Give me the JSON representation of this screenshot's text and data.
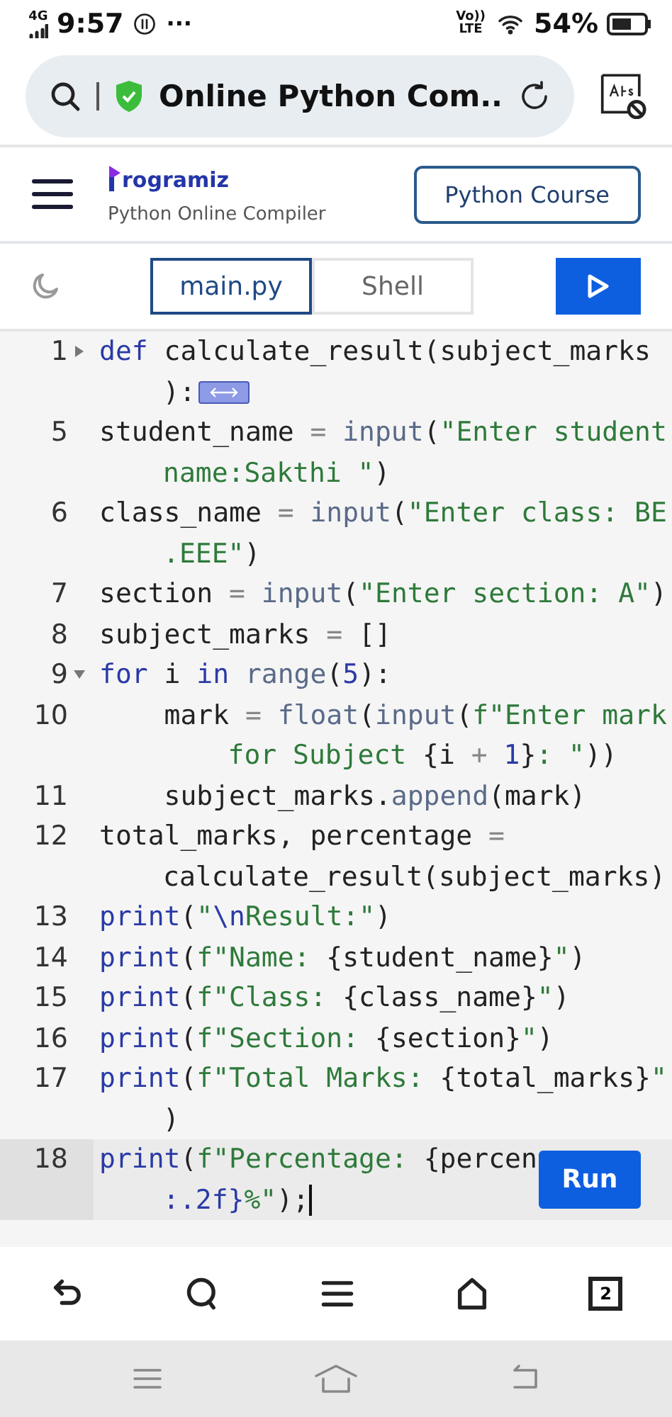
{
  "status_bar": {
    "network": "4G",
    "time": "9:57",
    "more": "···",
    "volte_top": "Vo))",
    "volte_bottom": "LTE",
    "battery": "54%"
  },
  "address_bar": {
    "title": "Online Python Com.."
  },
  "header": {
    "logo_text": "rogramiz",
    "subtitle": "Python Online Compiler",
    "course_button": "Python Course"
  },
  "tabs": [
    {
      "label": "main.py",
      "selected": true
    },
    {
      "label": "Shell",
      "selected": false
    }
  ],
  "editor": {
    "lines": [
      {
        "number": "1",
        "foldable": true,
        "collapsed": true,
        "active": false,
        "rows": [
          {
            "tokens": [
              {
                "text": "def",
                "kind": "keyword"
              },
              {
                "text": " calculate_result(subject_marks",
                "kind": "plain"
              }
            ]
          },
          {
            "tokens": [
              {
                "text": "):",
                "kind": "plain"
              }
            ]
          }
        ]
      },
      {
        "number": "5",
        "foldable": false,
        "active": false,
        "rows": [
          {
            "tokens": [
              {
                "text": "student_name ",
                "kind": "plain"
              },
              {
                "text": "= ",
                "kind": "operator"
              },
              {
                "text": "input",
                "kind": "builtin"
              },
              {
                "text": "(",
                "kind": "plain"
              },
              {
                "text": "\"Enter student",
                "kind": "string"
              }
            ]
          },
          {
            "tokens": [
              {
                "text": "name:Sakthi \"",
                "kind": "string"
              },
              {
                "text": ")",
                "kind": "plain"
              }
            ]
          }
        ]
      },
      {
        "number": "6",
        "foldable": false,
        "active": false,
        "rows": [
          {
            "tokens": [
              {
                "text": "class_name ",
                "kind": "plain"
              },
              {
                "text": "= ",
                "kind": "operator"
              },
              {
                "text": "input",
                "kind": "builtin"
              },
              {
                "text": "(",
                "kind": "plain"
              },
              {
                "text": "\"Enter class: BE",
                "kind": "string"
              }
            ]
          },
          {
            "tokens": [
              {
                "text": ".EEE\"",
                "kind": "string"
              },
              {
                "text": ")",
                "kind": "plain"
              }
            ]
          }
        ]
      },
      {
        "number": "7",
        "foldable": false,
        "active": false,
        "rows": [
          {
            "tokens": [
              {
                "text": "section ",
                "kind": "plain"
              },
              {
                "text": "= ",
                "kind": "operator"
              },
              {
                "text": "input",
                "kind": "builtin"
              },
              {
                "text": "(",
                "kind": "plain"
              },
              {
                "text": "\"Enter section: A\"",
                "kind": "string"
              },
              {
                "text": ")",
                "kind": "plain"
              }
            ]
          }
        ]
      },
      {
        "number": "8",
        "foldable": false,
        "active": false,
        "rows": [
          {
            "tokens": [
              {
                "text": "subject_marks ",
                "kind": "plain"
              },
              {
                "text": "= ",
                "kind": "operator"
              },
              {
                "text": "[]",
                "kind": "plain"
              }
            ]
          }
        ]
      },
      {
        "number": "9",
        "foldable": true,
        "collapsed": false,
        "active": false,
        "rows": [
          {
            "tokens": [
              {
                "text": "for",
                "kind": "keyword"
              },
              {
                "text": " i ",
                "kind": "plain"
              },
              {
                "text": "in ",
                "kind": "keyword"
              },
              {
                "text": "range",
                "kind": "builtin"
              },
              {
                "text": "(",
                "kind": "plain"
              },
              {
                "text": "5",
                "kind": "number"
              },
              {
                "text": "):",
                "kind": "plain"
              }
            ]
          }
        ]
      },
      {
        "number": "10",
        "foldable": false,
        "active": false,
        "rows": [
          {
            "tokens": [
              {
                "text": "    mark ",
                "kind": "plain"
              },
              {
                "text": "= ",
                "kind": "operator"
              },
              {
                "text": "float",
                "kind": "builtin"
              },
              {
                "text": "(",
                "kind": "plain"
              },
              {
                "text": "input",
                "kind": "builtin"
              },
              {
                "text": "(",
                "kind": "plain"
              },
              {
                "text": "f\"Enter mark",
                "kind": "string"
              }
            ]
          },
          {
            "tokens": [
              {
                "text": "    for Subject ",
                "kind": "string"
              },
              {
                "text": "{i ",
                "kind": "plain"
              },
              {
                "text": "+ ",
                "kind": "operator"
              },
              {
                "text": "1",
                "kind": "number"
              },
              {
                "text": "}",
                "kind": "plain"
              },
              {
                "text": ": \"",
                "kind": "string"
              },
              {
                "text": "))",
                "kind": "plain"
              }
            ]
          }
        ]
      },
      {
        "number": "11",
        "foldable": false,
        "active": false,
        "rows": [
          {
            "tokens": [
              {
                "text": "    subject_marks.",
                "kind": "plain"
              },
              {
                "text": "append",
                "kind": "builtin"
              },
              {
                "text": "(mark)",
                "kind": "plain"
              }
            ]
          }
        ]
      },
      {
        "number": "12",
        "foldable": false,
        "active": false,
        "rows": [
          {
            "tokens": [
              {
                "text": "total_marks, percentage ",
                "kind": "plain"
              },
              {
                "text": "=",
                "kind": "operator"
              }
            ]
          },
          {
            "tokens": [
              {
                "text": "calculate_result(subject_marks)",
                "kind": "plain"
              }
            ]
          }
        ]
      },
      {
        "number": "13",
        "foldable": false,
        "active": false,
        "rows": [
          {
            "tokens": [
              {
                "text": "print",
                "kind": "keyword"
              },
              {
                "text": "(",
                "kind": "plain"
              },
              {
                "text": "\"",
                "kind": "string"
              },
              {
                "text": "\\n",
                "kind": "escape"
              },
              {
                "text": "Result:\"",
                "kind": "string"
              },
              {
                "text": ")",
                "kind": "plain"
              }
            ]
          }
        ]
      },
      {
        "number": "14",
        "foldable": false,
        "active": false,
        "rows": [
          {
            "tokens": [
              {
                "text": "print",
                "kind": "keyword"
              },
              {
                "text": "(",
                "kind": "plain"
              },
              {
                "text": "f\"Name: ",
                "kind": "string"
              },
              {
                "text": "{student_name}",
                "kind": "plain"
              },
              {
                "text": "\"",
                "kind": "string"
              },
              {
                "text": ")",
                "kind": "plain"
              }
            ]
          }
        ]
      },
      {
        "number": "15",
        "foldable": false,
        "active": false,
        "rows": [
          {
            "tokens": [
              {
                "text": "print",
                "kind": "keyword"
              },
              {
                "text": "(",
                "kind": "plain"
              },
              {
                "text": "f\"Class: ",
                "kind": "string"
              },
              {
                "text": "{class_name}",
                "kind": "plain"
              },
              {
                "text": "\"",
                "kind": "string"
              },
              {
                "text": ")",
                "kind": "plain"
              }
            ]
          }
        ]
      },
      {
        "number": "16",
        "foldable": false,
        "active": false,
        "rows": [
          {
            "tokens": [
              {
                "text": "print",
                "kind": "keyword"
              },
              {
                "text": "(",
                "kind": "plain"
              },
              {
                "text": "f\"Section: ",
                "kind": "string"
              },
              {
                "text": "{section}",
                "kind": "plain"
              },
              {
                "text": "\"",
                "kind": "string"
              },
              {
                "text": ")",
                "kind": "plain"
              }
            ]
          }
        ]
      },
      {
        "number": "17",
        "foldable": false,
        "active": false,
        "rows": [
          {
            "tokens": [
              {
                "text": "print",
                "kind": "keyword"
              },
              {
                "text": "(",
                "kind": "plain"
              },
              {
                "text": "f\"Total Marks: ",
                "kind": "string"
              },
              {
                "text": "{total_marks}",
                "kind": "plain"
              },
              {
                "text": "\"",
                "kind": "string"
              }
            ]
          },
          {
            "tokens": [
              {
                "text": ")",
                "kind": "plain"
              }
            ]
          }
        ]
      },
      {
        "number": "18",
        "foldable": false,
        "active": true,
        "rows": [
          {
            "tokens": [
              {
                "text": "print",
                "kind": "keyword"
              },
              {
                "text": "(",
                "kind": "plain"
              },
              {
                "text": "f\"Percentage: ",
                "kind": "string"
              },
              {
                "text": "{percen",
                "kind": "plain"
              }
            ]
          },
          {
            "tokens": [
              {
                "text": ":.2f}",
                "kind": "escape"
              },
              {
                "text": "%\"",
                "kind": "string"
              },
              {
                "text": ");",
                "kind": "plain"
              }
            ]
          }
        ]
      }
    ],
    "run_button": "Run"
  },
  "browser_bar": {
    "tab_count": "2"
  }
}
